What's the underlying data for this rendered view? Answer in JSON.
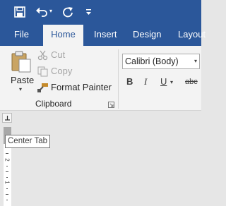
{
  "qat": {
    "save_icon": "save-icon",
    "undo_icon": "undo-icon",
    "redo_icon": "redo-icon",
    "customize_icon": "customize-qat-icon"
  },
  "tabs": {
    "file": "File",
    "home": "Home",
    "insert": "Insert",
    "design": "Design",
    "layout": "Layout"
  },
  "clipboard": {
    "paste": "Paste",
    "cut": "Cut",
    "copy": "Copy",
    "format_painter": "Format Painter",
    "group_label": "Clipboard"
  },
  "font": {
    "name": "Calibri (Body)",
    "bold": "B",
    "italic": "I",
    "underline": "U",
    "strike": "abc"
  },
  "tab_selector": {
    "tooltip": "Center Tab"
  },
  "ruler": {
    "numbers": [
      "2",
      "1"
    ]
  },
  "colors": {
    "ribbon_blue": "#2b579a",
    "ribbon_bg": "#f3f3f3"
  }
}
